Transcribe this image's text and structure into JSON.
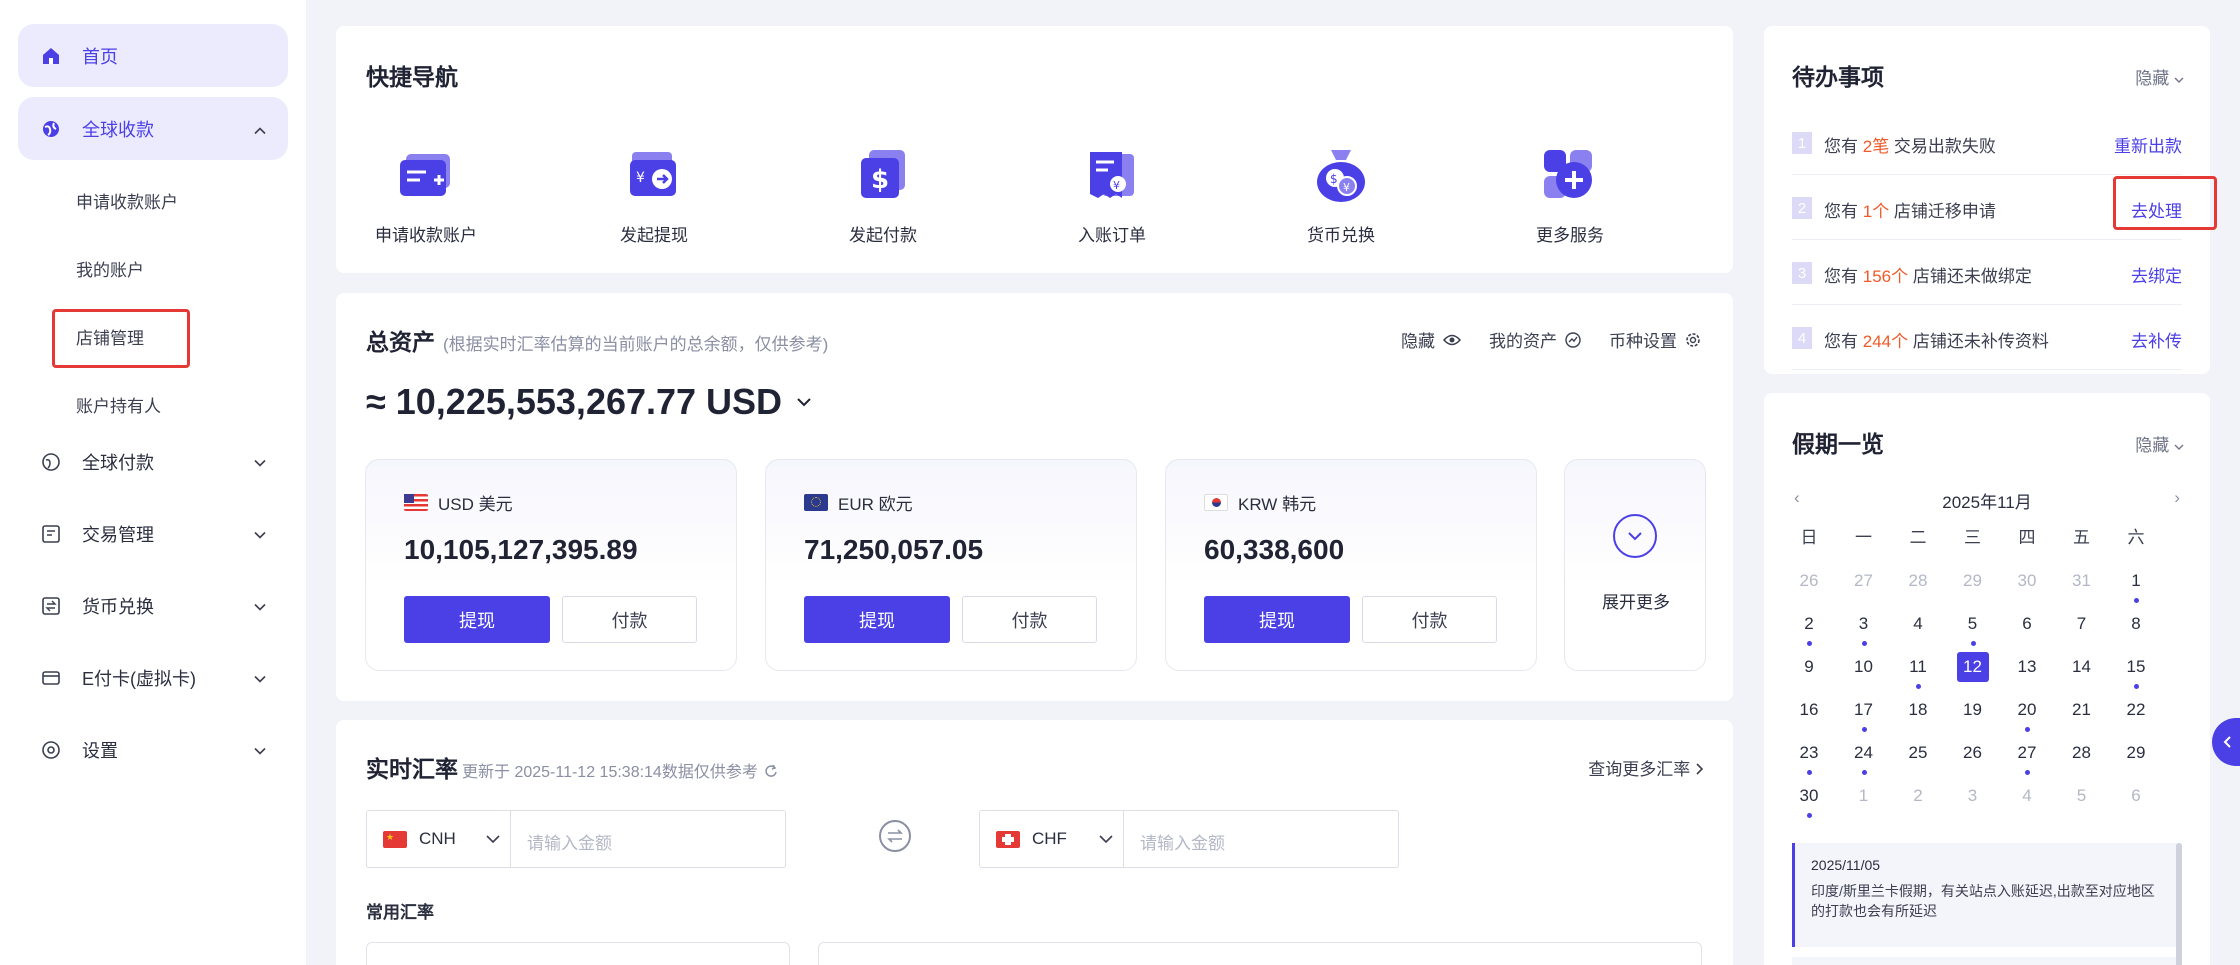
{
  "sidebar": {
    "home": "首页",
    "global_collect": "全球收款",
    "sub_items": [
      "申请收款账户",
      "我的账户",
      "店铺管理",
      "账户持有人"
    ],
    "global_pay": "全球付款",
    "trade_mgmt": "交易管理",
    "fx": "货币兑换",
    "ecard": "E付卡(虚拟卡)",
    "settings": "设置"
  },
  "quick_nav": {
    "title": "快捷导航",
    "items": [
      {
        "label": "申请收款账户",
        "icon": "apply-account-icon"
      },
      {
        "label": "发起提现",
        "icon": "withdraw-icon"
      },
      {
        "label": "发起付款",
        "icon": "payment-icon"
      },
      {
        "label": "入账订单",
        "icon": "order-icon"
      },
      {
        "label": "货币兑换",
        "icon": "exchange-icon"
      },
      {
        "label": "更多服务",
        "icon": "more-services-icon"
      }
    ]
  },
  "assets": {
    "title": "总资产",
    "hint": "(根据实时汇率估算的当前账户的总余额，仅供参考)",
    "actions": {
      "hide": "隐藏",
      "my_assets": "我的资产",
      "currency_settings": "币种设置"
    },
    "total": "≈ 10,225,553,267.77 USD",
    "currencies": [
      {
        "name": "USD 美元",
        "amount": "10,105,127,395.89",
        "flag": "us"
      },
      {
        "name": "EUR 欧元",
        "amount": "71,250,057.05",
        "flag": "eu"
      },
      {
        "name": "KRW 韩元",
        "amount": "60,338,600",
        "flag": "kr"
      }
    ],
    "withdraw_label": "提现",
    "pay_label": "付款",
    "expand_more": "展开更多"
  },
  "rates": {
    "title": "实时汇率",
    "updated": "更新于 2025-11-12 15:38:14数据仅供参考",
    "more": "查询更多汇率",
    "from_currency": "CNH",
    "to_currency": "CHF",
    "amount_placeholder": "请输入金额",
    "common": "常用汇率"
  },
  "todo": {
    "title": "待办事项",
    "hide": "隐藏",
    "rows": [
      {
        "num": "1",
        "pre": "您有 ",
        "count": "2笔",
        "post": " 交易出款失败",
        "action": "重新出款"
      },
      {
        "num": "2",
        "pre": "您有 ",
        "count": "1个",
        "post": " 店铺迁移申请",
        "action": "去处理"
      },
      {
        "num": "3",
        "pre": "您有 ",
        "count": "156个",
        "post": " 店铺还未做绑定",
        "action": "去绑定"
      },
      {
        "num": "4",
        "pre": "您有 ",
        "count": "244个",
        "post": " 店铺还未补传资料",
        "action": "去补传"
      }
    ]
  },
  "holiday": {
    "title": "假期一览",
    "hide": "隐藏",
    "month": "2025年11月",
    "weekdays": [
      "日",
      "一",
      "二",
      "三",
      "四",
      "五",
      "六"
    ],
    "today": "12",
    "note_date": "2025/11/05",
    "note_text": "印度/斯里兰卡假期，有关站点入账延迟,出款至对应地区的打款也会有所延迟"
  },
  "colors": {
    "accent": "#4b3fe6",
    "highlight": "#f05a28",
    "alert_box": "#e53935"
  }
}
